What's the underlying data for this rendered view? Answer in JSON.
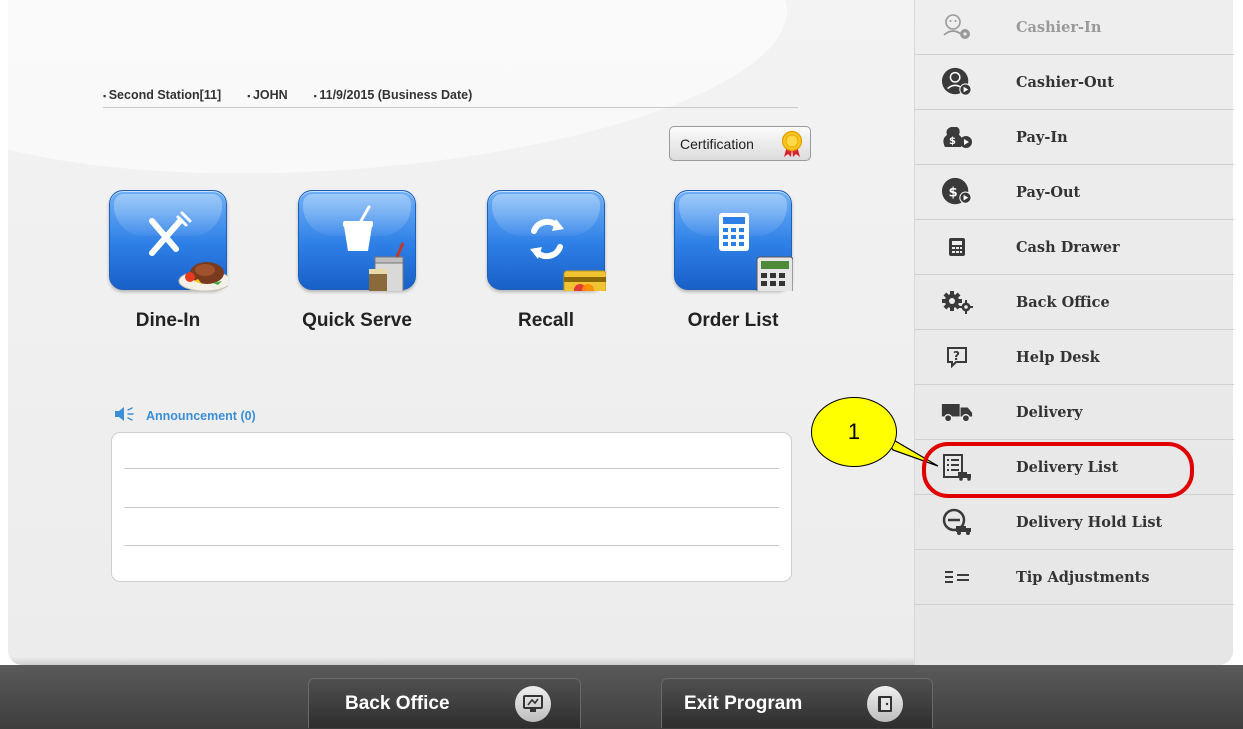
{
  "info_bar": {
    "station": "Second Station[11]",
    "user": "JOHN",
    "business_date": "11/9/2015 (Business Date)"
  },
  "certification": {
    "label": "Certification",
    "icon": "award-ribbon-icon"
  },
  "tiles": [
    {
      "label": "Dine-In",
      "icon": "fork-knife-plate-icon"
    },
    {
      "label": "Quick Serve",
      "icon": "cup-icon"
    },
    {
      "label": "Recall",
      "icon": "refresh-card-icon"
    },
    {
      "label": "Order List",
      "icon": "calculator-icon"
    }
  ],
  "announcement": {
    "title": "Announcement (0)",
    "icon": "speaker-icon"
  },
  "sidebar": {
    "items": [
      {
        "label": "Cashier-In",
        "icon": "cashier-in-icon",
        "enabled": false
      },
      {
        "label": "Cashier-Out",
        "icon": "cashier-out-icon",
        "enabled": true
      },
      {
        "label": "Pay-In",
        "icon": "pay-in-icon",
        "enabled": true
      },
      {
        "label": "Pay-Out",
        "icon": "pay-out-icon",
        "enabled": true
      },
      {
        "label": "Cash Drawer",
        "icon": "cash-drawer-icon",
        "enabled": true
      },
      {
        "label": "Back Office",
        "icon": "gears-icon",
        "enabled": true
      },
      {
        "label": "Help Desk",
        "icon": "help-icon",
        "enabled": true
      },
      {
        "label": "Delivery",
        "icon": "truck-icon",
        "enabled": true
      },
      {
        "label": "Delivery List",
        "icon": "delivery-list-icon",
        "enabled": true
      },
      {
        "label": "Delivery Hold List",
        "icon": "delivery-hold-icon",
        "enabled": true
      },
      {
        "label": "Tip Adjustments",
        "icon": "tip-adjust-icon",
        "enabled": true
      }
    ]
  },
  "callout": {
    "number": "1",
    "target": "Delivery List"
  },
  "bottom": {
    "back_office": "Back Office",
    "exit_program": "Exit Program"
  },
  "colors": {
    "tile_blue": "#2d7fe6",
    "announcement_blue": "#3a8fd8",
    "callout_yellow": "#ffff00",
    "highlight_red": "#e00000",
    "bottom_bar": "#3e3e3e"
  }
}
